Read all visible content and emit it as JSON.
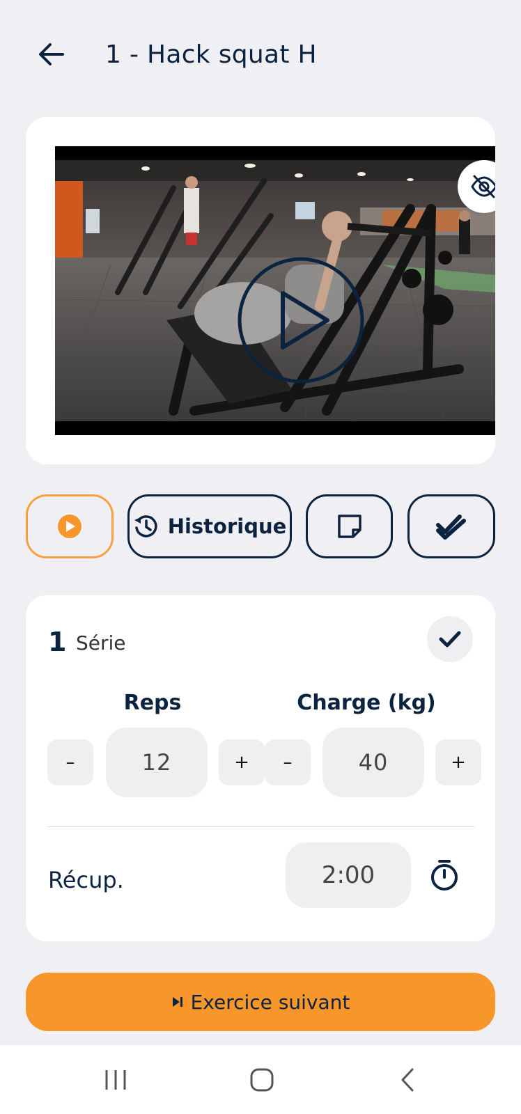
{
  "header": {
    "back_icon": "arrow-left-icon",
    "title": "1 - Hack squat H"
  },
  "video": {
    "hide_icon": "eye-off-icon",
    "play_icon": "play-circle-icon"
  },
  "actions": {
    "play_icon": "play-circle-filled-icon",
    "history_icon": "history-icon",
    "history_label": "Historique",
    "note_icon": "sticky-note-icon",
    "done_icon": "double-check-icon"
  },
  "set": {
    "number": "1",
    "label": "Série",
    "check_icon": "check-icon",
    "reps": {
      "label": "Reps",
      "value": "12",
      "minus": "–",
      "plus": "+"
    },
    "charge": {
      "label": "Charge (kg)",
      "value": "40",
      "minus": "–",
      "plus": "+"
    },
    "recup": {
      "label": "Récup.",
      "value": "2:00",
      "timer_icon": "stopwatch-icon"
    }
  },
  "next": {
    "icon": "skip-next-icon",
    "label": "Exercice suivant"
  },
  "navbar": {
    "recents_icon": "recents-icon",
    "home_icon": "home-icon",
    "back_icon": "back-chevron-icon"
  },
  "colors": {
    "primary": "#0c2340",
    "accent": "#f7962b",
    "background": "#f0f0f4",
    "card": "#ffffff",
    "field": "#efeff2"
  }
}
